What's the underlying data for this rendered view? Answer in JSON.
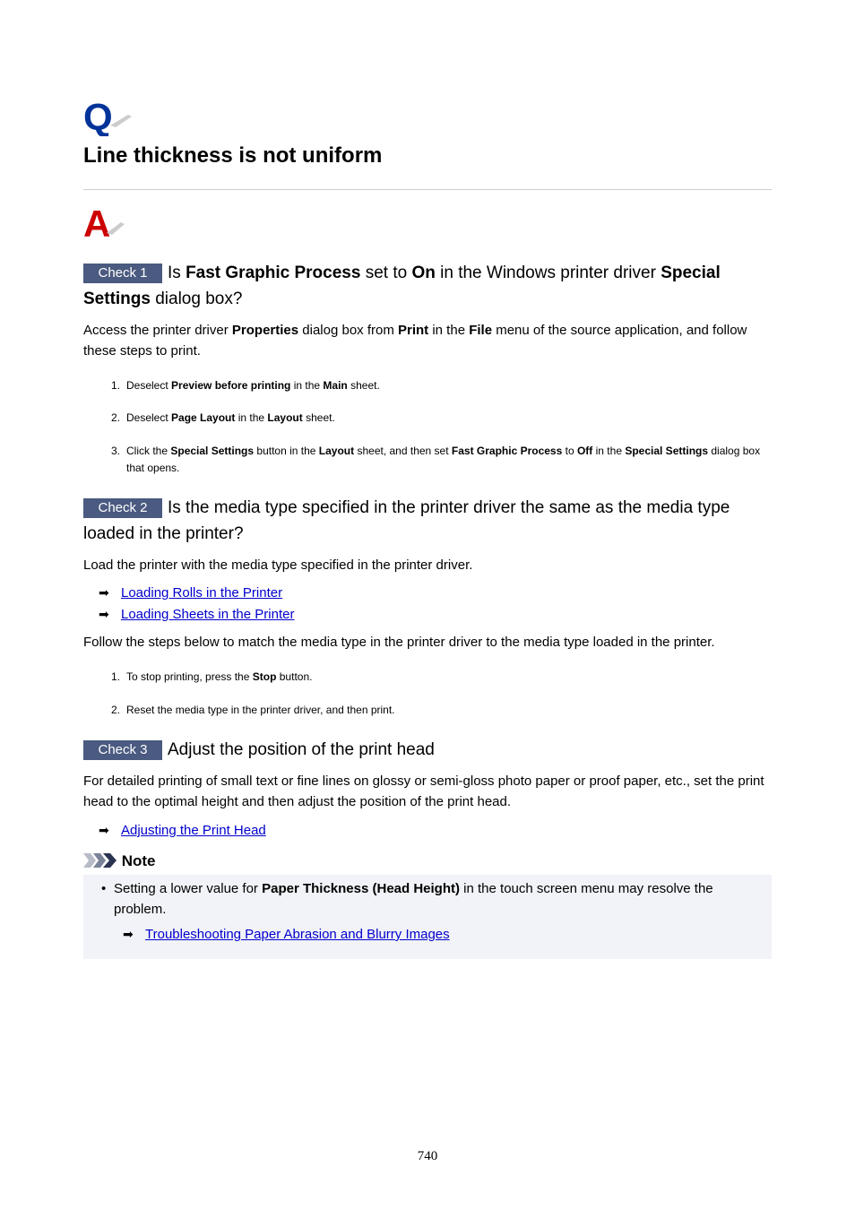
{
  "title": "Line thickness is not uniform",
  "icons": {
    "question": "question-q-icon",
    "answer": "answer-a-icon",
    "arrow": "right-arrow-icon",
    "note": "note-chevrons-icon"
  },
  "colors": {
    "badge": "#4a5a80",
    "link": "#0000cc",
    "q_icon": "#003399",
    "a_icon": "#cc0000",
    "note_bg": "#f2f3f8"
  },
  "check1": {
    "badge": "Check 1",
    "h": [
      "Is ",
      "Fast Graphic Process",
      " set to ",
      "On",
      " in the Windows printer driver ",
      "Special Settings",
      " dialog box?"
    ],
    "p": [
      "Access the printer driver ",
      "Properties",
      " dialog box from ",
      "Print",
      " in the ",
      "File",
      " menu of the source application, and follow these steps to print."
    ],
    "steps": [
      {
        "num": "1.",
        "parts": [
          "Deselect ",
          "Preview before printing",
          " in the ",
          "Main",
          " sheet."
        ]
      },
      {
        "num": "2.",
        "parts": [
          "Deselect ",
          "Page Layout",
          " in the ",
          "Layout",
          " sheet."
        ]
      },
      {
        "num": "3.",
        "parts": [
          "Click the ",
          "Special Settings",
          " button in the ",
          "Layout",
          " sheet, and then set ",
          "Fast Graphic Process",
          " to ",
          "Off",
          " in the ",
          "Special Settings",
          " dialog box that opens."
        ]
      }
    ]
  },
  "check2": {
    "badge": "Check 2",
    "heading": "Is the media type specified in the printer driver the same as the media type loaded in the printer?",
    "p1": "Load the printer with the media type specified in the printer driver.",
    "links": [
      "Loading Rolls in the Printer",
      "Loading Sheets in the Printer"
    ],
    "p2": "Follow the steps below to match the media type in the printer driver to the media type loaded in the printer.",
    "steps": [
      {
        "num": "1.",
        "parts": [
          "To stop printing, press the ",
          "Stop",
          " button."
        ]
      },
      {
        "num": "2.",
        "parts": [
          "Reset the media type in the printer driver, and then print."
        ]
      }
    ]
  },
  "check3": {
    "badge": "Check 3",
    "heading": "Adjust the position of the print head",
    "p": "For detailed printing of small text or fine lines on glossy or semi-gloss photo paper or proof paper, etc., set the print head to the optimal height and then adjust the position of the print head.",
    "link": "Adjusting the Print Head"
  },
  "note": {
    "label": "Note",
    "bullet": "•",
    "parts": [
      "Setting a lower value for ",
      "Paper Thickness (Head Height)",
      " in the touch screen menu may resolve the problem."
    ],
    "link": "Troubleshooting Paper Abrasion and Blurry Images"
  },
  "page_number": "740"
}
